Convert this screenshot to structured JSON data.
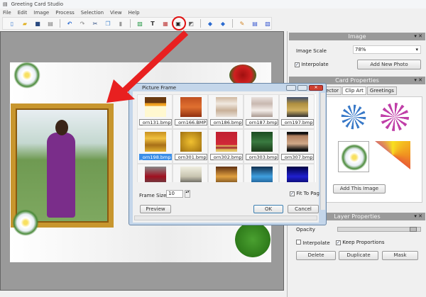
{
  "app": {
    "title": "Greeting Card Studio"
  },
  "menu": [
    "File",
    "Edit",
    "Image",
    "Process",
    "Selection",
    "View",
    "Help"
  ],
  "toolbar": [
    {
      "icon": "new-icon",
      "glyph": "▯",
      "color": "#3a7ad0"
    },
    {
      "icon": "open-icon",
      "glyph": "▰",
      "color": "#e0b020"
    },
    {
      "icon": "save-icon",
      "glyph": "■",
      "color": "#2a4a80"
    },
    {
      "icon": "print-icon",
      "glyph": "▤",
      "color": "#777"
    },
    {
      "icon": "undo-icon",
      "glyph": "↶",
      "color": "#2a6ad0"
    },
    {
      "icon": "redo-icon",
      "glyph": "↷",
      "color": "#999"
    },
    {
      "icon": "cut-icon",
      "glyph": "✂",
      "color": "#2a4a80"
    },
    {
      "icon": "copy-icon",
      "glyph": "❐",
      "color": "#4a8ad0"
    },
    {
      "icon": "paste-icon",
      "glyph": "▮",
      "color": "#999"
    },
    {
      "icon": "image-icon",
      "glyph": "▨",
      "color": "#2a9a4a"
    },
    {
      "icon": "text-icon",
      "glyph": "T",
      "color": "#333"
    },
    {
      "icon": "clipart-icon",
      "glyph": "▦",
      "color": "#c04040"
    },
    {
      "icon": "picture-frame-icon",
      "glyph": "▣",
      "color": "#222"
    },
    {
      "icon": "shape-icon",
      "glyph": "◩",
      "color": "#666"
    },
    {
      "icon": "bring-forward-icon",
      "glyph": "◆",
      "color": "#2a6ad0"
    },
    {
      "icon": "send-backward-icon",
      "glyph": "◆",
      "color": "#2a6ad0"
    },
    {
      "icon": "effects-icon",
      "glyph": "✎",
      "color": "#d08020"
    },
    {
      "icon": "page-icon",
      "glyph": "▤",
      "color": "#3a5ad0"
    },
    {
      "icon": "properties-icon",
      "glyph": "▧",
      "color": "#3a5ad0"
    }
  ],
  "image_panel": {
    "title": "Image",
    "scale_label": "Image Scale",
    "scale_value": "78%",
    "interpolate_label": "Interpolate",
    "interpolate_checked": true,
    "add_photo": "Add New Photo"
  },
  "card_panel": {
    "title": "Card Properties",
    "tabs": [
      "ector",
      "Clip Art",
      "Greetings"
    ],
    "active_tab": "Clip Art",
    "add_image": "Add This Image"
  },
  "layer_panel": {
    "title": "Layer Properties",
    "opacity_label": "Opacity",
    "opacity": 0.95,
    "interpolate_label": "Interpolate",
    "interpolate_checked": false,
    "keep_label": "Keep Proportions",
    "keep_checked": true,
    "delete": "Delete",
    "duplicate": "Duplicate",
    "mask": "Mask"
  },
  "dialog": {
    "title": "Picture Frame",
    "frame_size_label": "Frame Size",
    "frame_size": "10",
    "fit_label": "Fit To Pag",
    "fit_checked": true,
    "preview": "Preview",
    "ok": "OK",
    "cancel": "Cancel",
    "items": [
      {
        "name": "_orn131.bmp",
        "bg": "linear-gradient(#6a3a10 0,#6a3a10 30%,#f0a020 30%,#f0a020 45%,#fff8d0 45%)"
      },
      {
        "name": "_orn166.BMP",
        "bg": "linear-gradient(#c05020,#e07030,#903010)"
      },
      {
        "name": "_orn186.bmp",
        "bg": "linear-gradient(#d0b8a0,#f0e8e0,#c8b098,#e8e0d8)"
      },
      {
        "name": "_orn187.bmp",
        "bg": "linear-gradient(#e8e0dc,#c8b8b0,#f4eeea,#a89890)"
      },
      {
        "name": "_orn197.bmp",
        "bg": "linear-gradient(#405070,#b09040,#d0b060,#303030)"
      },
      {
        "name": "_orn198.bmp",
        "bg": "linear-gradient(#c89020,#f0c040,#a87018,#e0b030)",
        "selected": true
      },
      {
        "name": "_orn301.bmp",
        "bg": "radial-gradient(ellipse,#f0c030,#a07010)"
      },
      {
        "name": "_orn302.bmp",
        "bg": "linear-gradient(#c02030 0,#d02838 65%,#e0c060 70%,#a02030 80%,#e0c060 90%)"
      },
      {
        "name": "_orn303.bmp",
        "bg": "linear-gradient(#1a4a20,#3a7a40,#1a3a18)"
      },
      {
        "name": "_orn307.bmp",
        "bg": "linear-gradient(#111 0,#111 10%,#b08060 20%,#d0a888 60%,#111 90%)"
      },
      {
        "name": "",
        "bg": "linear-gradient(#888,#a01020,#555)"
      },
      {
        "name": "",
        "bg": "linear-gradient(#f0eee0,#c8c4b0,#333)"
      },
      {
        "name": "",
        "bg": "linear-gradient(#603010,#e0a040,#503010)"
      },
      {
        "name": "",
        "bg": "linear-gradient(#103050,#40a0e0,#104070)"
      },
      {
        "name": "",
        "bg": "linear-gradient(#000040,#2020d0,#000040)"
      }
    ]
  }
}
